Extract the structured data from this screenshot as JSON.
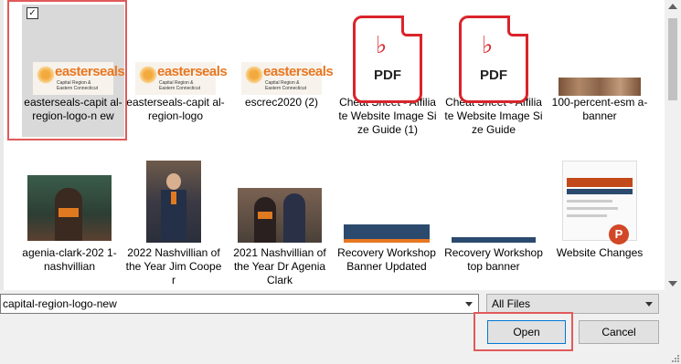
{
  "items": [
    {
      "name": "easterseals-capit al-region-logo-n ew",
      "type": "logo",
      "selected": true
    },
    {
      "name": "easterseals-capit al-region-logo",
      "type": "logo"
    },
    {
      "name": "escrec2020 (2)",
      "type": "logo"
    },
    {
      "name": "Cheat Sheet - Affiliate Website Image Size Guide (1)",
      "type": "pdf"
    },
    {
      "name": "Cheat Sheet - Affiliate Website Image Size Guide",
      "type": "pdf"
    },
    {
      "name": "100-percent-esm a-banner",
      "type": "banner-photo"
    },
    {
      "name": "agenia-clark-202 1-nashvillian",
      "type": "photo"
    },
    {
      "name": "2022 Nashvillian of the Year Jim Cooper",
      "type": "photo"
    },
    {
      "name": "2021 Nashvillian of the Year Dr Agenia Clark",
      "type": "photo"
    },
    {
      "name": "Recovery Workshop Banner Updated",
      "type": "banner"
    },
    {
      "name": "Recovery Workshop top banner",
      "type": "banner"
    },
    {
      "name": "Website Changes",
      "type": "powerpoint"
    }
  ],
  "logo_text": {
    "name": "easterseals",
    "sub_line1": "Capital Region &",
    "sub_line2": "Eastern Connecticut"
  },
  "pdf_label": "PDF",
  "file_name_value": "capital-region-logo-new",
  "file_type_value": "All Files",
  "open_label": "Open",
  "cancel_label": "Cancel",
  "checkmark": "✓",
  "colors": {
    "highlight": "#e05a5a",
    "pdf_red": "#d9242b",
    "brand_orange": "#e87722"
  }
}
